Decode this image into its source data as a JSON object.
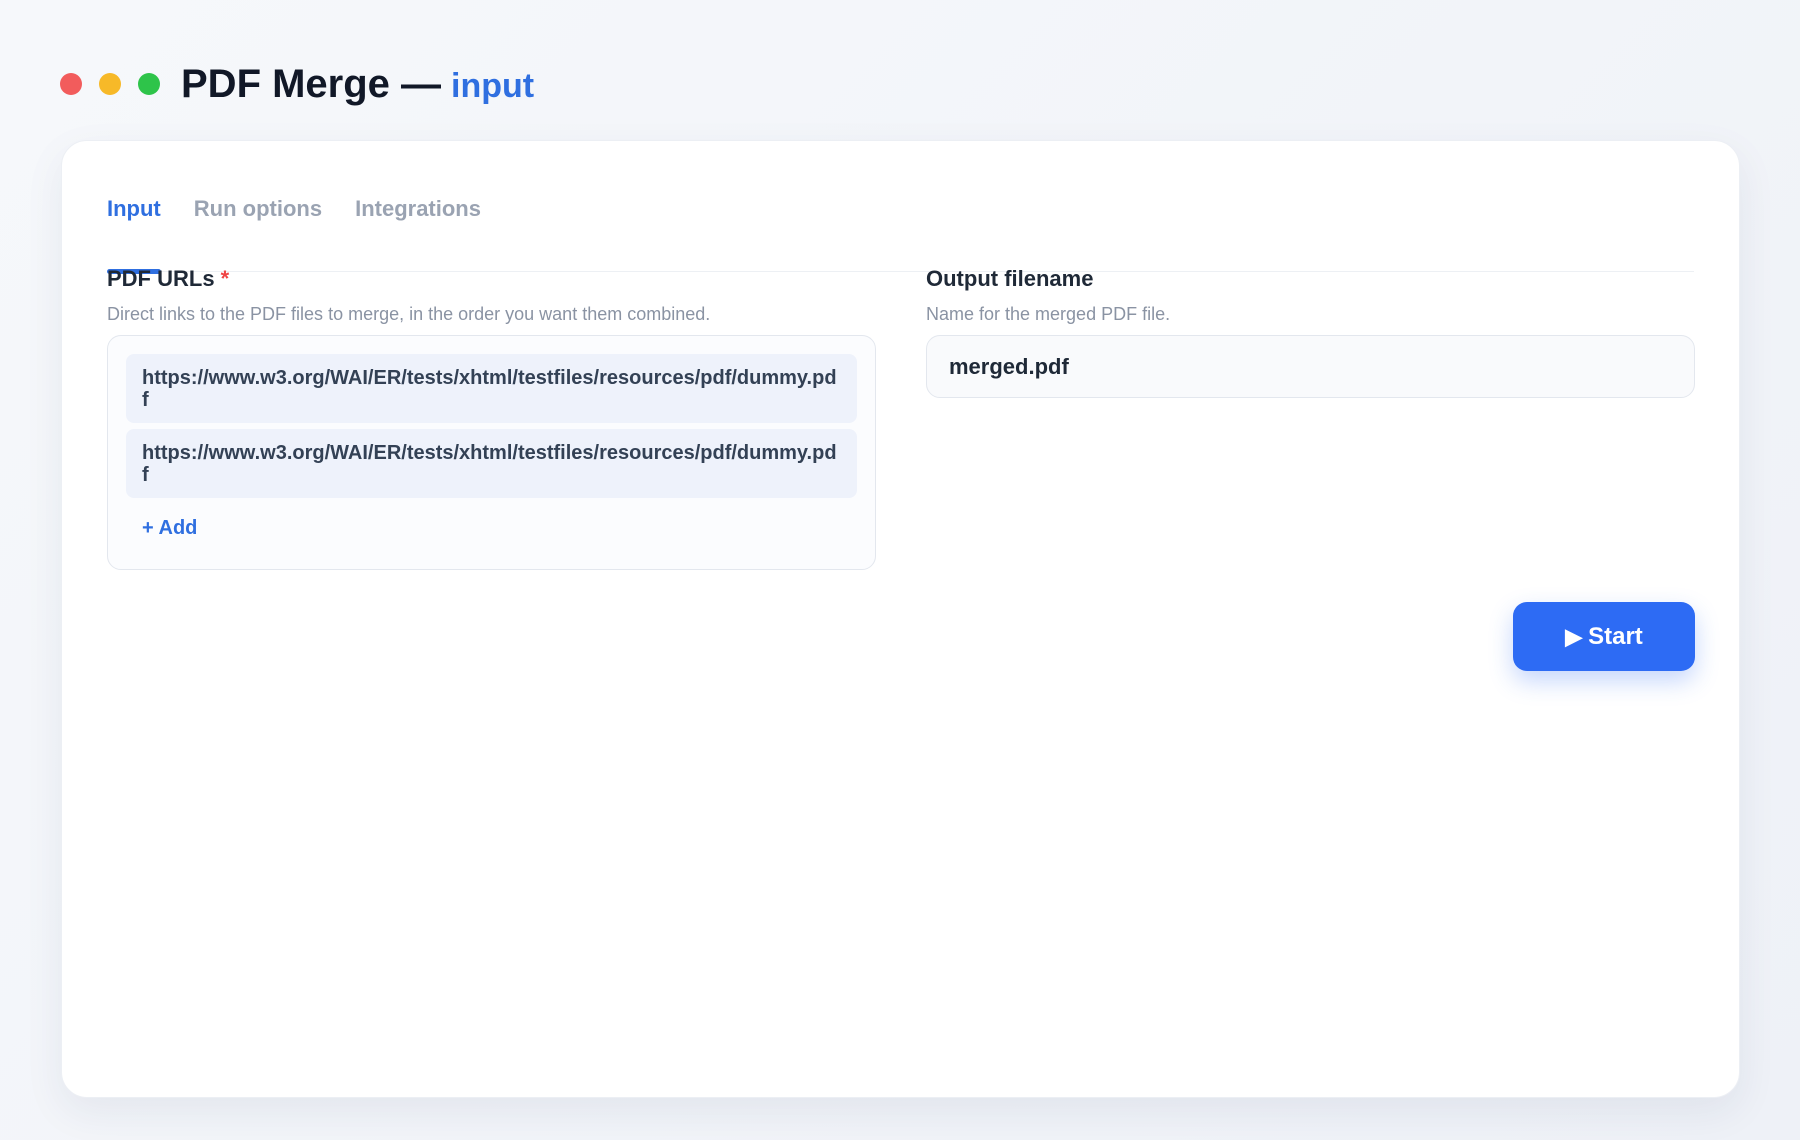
{
  "window": {
    "title": "PDF Merge —",
    "subtitle": "input",
    "controls": {
      "close_color": "#f25c5c",
      "minimize_color": "#f7b928",
      "maximize_color": "#2ec44a"
    }
  },
  "tabs": [
    {
      "label": "Input",
      "active": true
    },
    {
      "label": "Run options",
      "active": false
    },
    {
      "label": "Integrations",
      "active": false
    }
  ],
  "pdf_urls": {
    "label": "PDF URLs",
    "required_marker": "*",
    "help": "Direct links to the PDF files to merge, in the order you want them combined.",
    "items": [
      "https://www.w3.org/WAI/ER/tests/xhtml/testfiles/resources/pdf/dummy.pdf",
      "https://www.w3.org/WAI/ER/tests/xhtml/testfiles/resources/pdf/dummy.pdf"
    ],
    "add_label": "+ Add"
  },
  "output_filename": {
    "label": "Output filename",
    "help": "Name for the merged PDF file.",
    "value": "merged.pdf"
  },
  "actions": {
    "start_icon": "play-icon",
    "start_icon_glyph": "▶",
    "start_label": "Start"
  },
  "colors": {
    "accent": "#2f6fe0",
    "button": "#2d6bf4",
    "required": "#ef4444"
  }
}
